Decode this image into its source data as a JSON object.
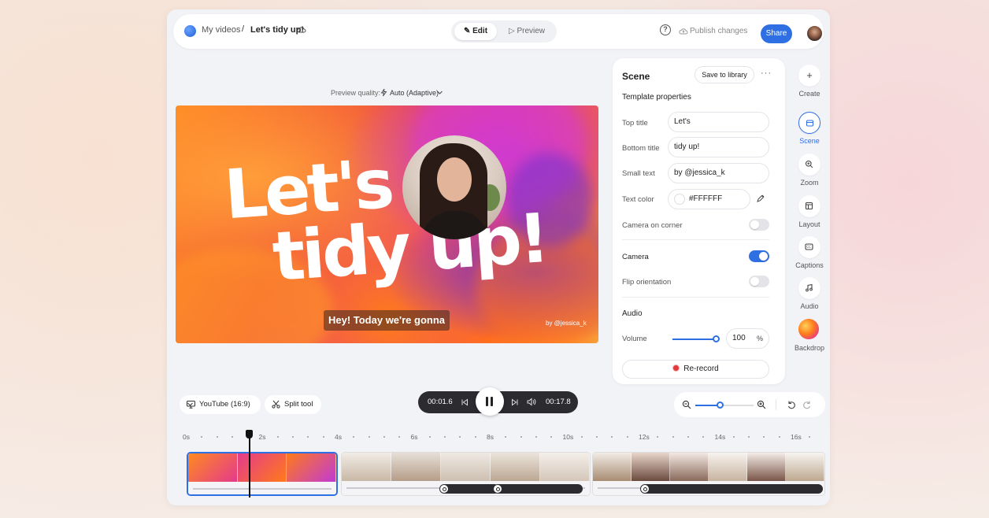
{
  "header": {
    "breadcrumb_parent": "My videos",
    "breadcrumb_sep": "/",
    "breadcrumb_current": "Let's tidy up!",
    "edit_label": "Edit",
    "preview_label": "Preview",
    "help_label": "?",
    "publish_label": "Publish changes",
    "share_label": "Share"
  },
  "preview": {
    "quality_label": "Preview quality:",
    "quality_value": "Auto (Adaptive)",
    "title_top": "Let's",
    "title_bottom": "tidy up!",
    "caption": "Hey! Today we're gonna",
    "small_text": "by @jessica_k"
  },
  "scene_panel": {
    "title": "Scene",
    "save_label": "Save to library",
    "more_label": "···",
    "template_heading": "Template properties",
    "top_title_label": "Top title",
    "top_title_value": "Let's",
    "bottom_title_label": "Bottom title",
    "bottom_title_value": "tidy up!",
    "small_text_label": "Small text",
    "small_text_value": "by @jessica_k",
    "text_color_label": "Text color",
    "text_color_value": "#FFFFFF",
    "camera_corner_label": "Camera on corner",
    "camera_corner_on": false,
    "camera_label": "Camera",
    "camera_on": true,
    "flip_label": "Flip orientation",
    "flip_on": false,
    "audio_heading": "Audio",
    "volume_label": "Volume",
    "volume_value": "100",
    "volume_unit": "%",
    "rerecord_label": "Re-record"
  },
  "rail": {
    "create": "Create",
    "scene": "Scene",
    "zoom": "Zoom",
    "layout": "Layout",
    "captions": "Captions",
    "audio": "Audio",
    "backdrop": "Backdrop"
  },
  "toolbar": {
    "aspect_label": "YouTube (16:9)",
    "split_label": "Split tool",
    "current_time": "00:01.6",
    "duration": "00:17.8"
  },
  "timeline": {
    "ticks": [
      "0s",
      "2s",
      "4s",
      "6s",
      "8s",
      "10s",
      "12s",
      "14s",
      "16s"
    ]
  },
  "colors": {
    "accent": "#2f6fe4",
    "dark": "#2b2b30",
    "record": "#e23a3a"
  }
}
